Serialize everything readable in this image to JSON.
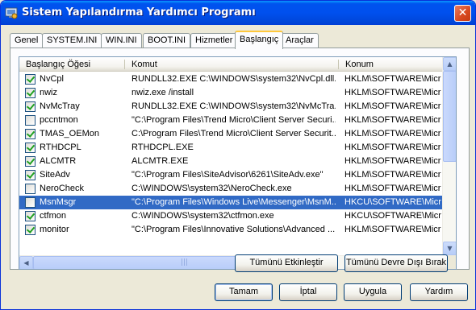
{
  "window": {
    "title": "Sistem Yapılandırma Yardımcı Programı",
    "close_label": "✕"
  },
  "tabs": [
    {
      "label": "Genel"
    },
    {
      "label": "SYSTEM.INI"
    },
    {
      "label": "WIN.INI"
    },
    {
      "label": "BOOT.INI"
    },
    {
      "label": "Hizmetler"
    },
    {
      "label": "Başlangıç",
      "active": true
    },
    {
      "label": "Araçlar"
    }
  ],
  "listview": {
    "columns": {
      "name": "Başlangıç Öğesi",
      "command": "Komut",
      "location": "Konum"
    },
    "rows": [
      {
        "checked": true,
        "name": "NvCpl",
        "command": "RUNDLL32.EXE C:\\WINDOWS\\system32\\NvCpl.dll...",
        "location": "HKLM\\SOFTWARE\\Micr"
      },
      {
        "checked": true,
        "name": "nwiz",
        "command": "nwiz.exe /install",
        "location": "HKLM\\SOFTWARE\\Micr"
      },
      {
        "checked": true,
        "name": "NvMcTray",
        "command": "RUNDLL32.EXE C:\\WINDOWS\\system32\\NvMcTra...",
        "location": "HKLM\\SOFTWARE\\Micr"
      },
      {
        "checked": false,
        "name": "pccntmon",
        "command": "\"C:\\Program Files\\Trend Micro\\Client Server Securi...",
        "location": "HKLM\\SOFTWARE\\Micr"
      },
      {
        "checked": true,
        "name": "TMAS_OEMon",
        "command": "C:\\Program Files\\Trend Micro\\Client Server Securit...",
        "location": "HKLM\\SOFTWARE\\Micr"
      },
      {
        "checked": true,
        "name": "RTHDCPL",
        "command": "RTHDCPL.EXE",
        "location": "HKLM\\SOFTWARE\\Micr"
      },
      {
        "checked": true,
        "name": "ALCMTR",
        "command": "ALCMTR.EXE",
        "location": "HKLM\\SOFTWARE\\Micr"
      },
      {
        "checked": true,
        "name": "SiteAdv",
        "command": "\"C:\\Program Files\\SiteAdvisor\\6261\\SiteAdv.exe\"",
        "location": "HKLM\\SOFTWARE\\Micr"
      },
      {
        "checked": false,
        "name": "NeroCheck",
        "command": "C:\\WINDOWS\\system32\\NeroCheck.exe",
        "location": "HKLM\\SOFTWARE\\Micr"
      },
      {
        "checked": false,
        "name": "MsnMsgr",
        "command": "\"C:\\Program Files\\Windows Live\\Messenger\\MsnM...",
        "location": "HKCU\\SOFTWARE\\Micr",
        "selected": true
      },
      {
        "checked": true,
        "name": "ctfmon",
        "command": "C:\\WINDOWS\\system32\\ctfmon.exe",
        "location": "HKCU\\SOFTWARE\\Micr"
      },
      {
        "checked": true,
        "name": "monitor",
        "command": "\"C:\\Program Files\\Innovative Solutions\\Advanced ...",
        "location": "HKLM\\SOFTWARE\\Micr"
      }
    ]
  },
  "actions": {
    "enable_all": "Tümünü Etkinleştir",
    "disable_all": "Tümünü Devre Dışı Bırak"
  },
  "dialog_buttons": {
    "ok": "Tamam",
    "cancel": "İptal",
    "apply": "Uygula",
    "help": "Yardım"
  },
  "colors": {
    "selection": "#316ac5",
    "titlebar": "#0053ee",
    "active_tab_accent": "#ffc83c"
  }
}
